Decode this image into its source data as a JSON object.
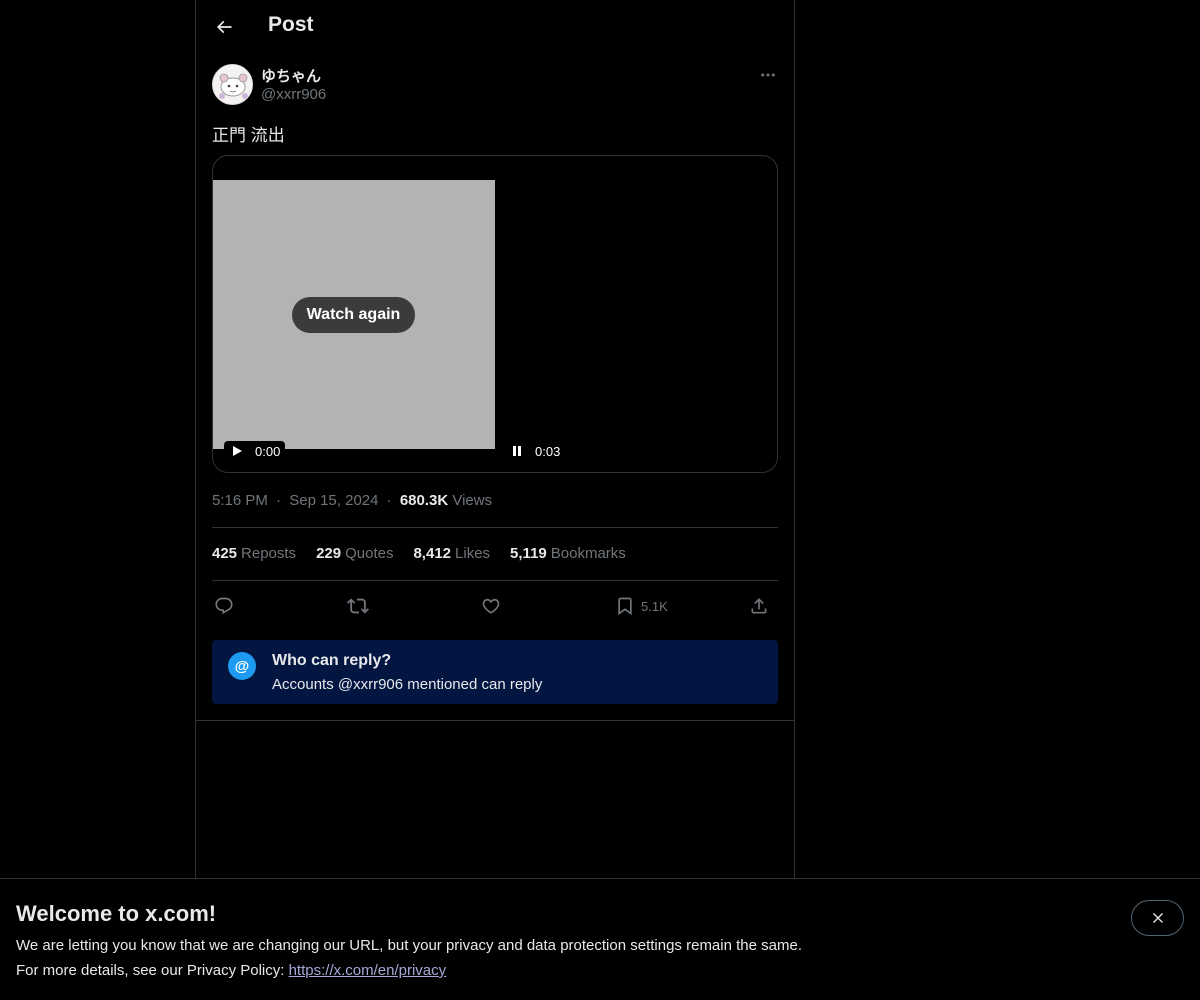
{
  "header": {
    "title": "Post",
    "back_icon": "arrow-left-icon"
  },
  "post": {
    "display_name": "ゆちゃん",
    "handle": "@xxrr906",
    "text": "正門 流出",
    "more_icon": "more-horizontal-icon"
  },
  "video": {
    "watch_again_label": "Watch again",
    "left_time": "0:00",
    "right_time": "0:03",
    "frame_color": "#b3b3b3"
  },
  "meta": {
    "time": "5:16 PM",
    "separator": "·",
    "date": "Sep 15, 2024",
    "views_count": "680.3K",
    "views_label": "Views"
  },
  "stats": [
    {
      "count": "425",
      "label": "Reposts"
    },
    {
      "count": "229",
      "label": "Quotes"
    },
    {
      "count": "8,412",
      "label": "Likes"
    },
    {
      "count": "5,119",
      "label": "Bookmarks"
    }
  ],
  "actions": {
    "reply_icon": "reply-icon",
    "repost_icon": "repost-icon",
    "like_icon": "heart-icon",
    "bookmark_icon": "bookmark-icon",
    "bookmark_count": "5.1K",
    "share_icon": "share-icon"
  },
  "reply_restriction": {
    "icon_glyph": "@",
    "title": "Who can reply?",
    "subtitle": "Accounts @xxrr906 mentioned can reply",
    "bg_color": "#031541",
    "icon_color": "#1d9bf0"
  },
  "banner": {
    "title": "Welcome to x.com!",
    "line1": "We are letting you know that we are changing our URL, but your privacy and data protection settings remain the same.",
    "line2_prefix": "For more details, see our Privacy Policy: ",
    "link": "https://x.com/en/privacy",
    "close_icon": "close-icon"
  },
  "colors": {
    "background": "#000000",
    "text": "#e7e9ea",
    "muted": "#71767b",
    "border": "#2f3336"
  }
}
